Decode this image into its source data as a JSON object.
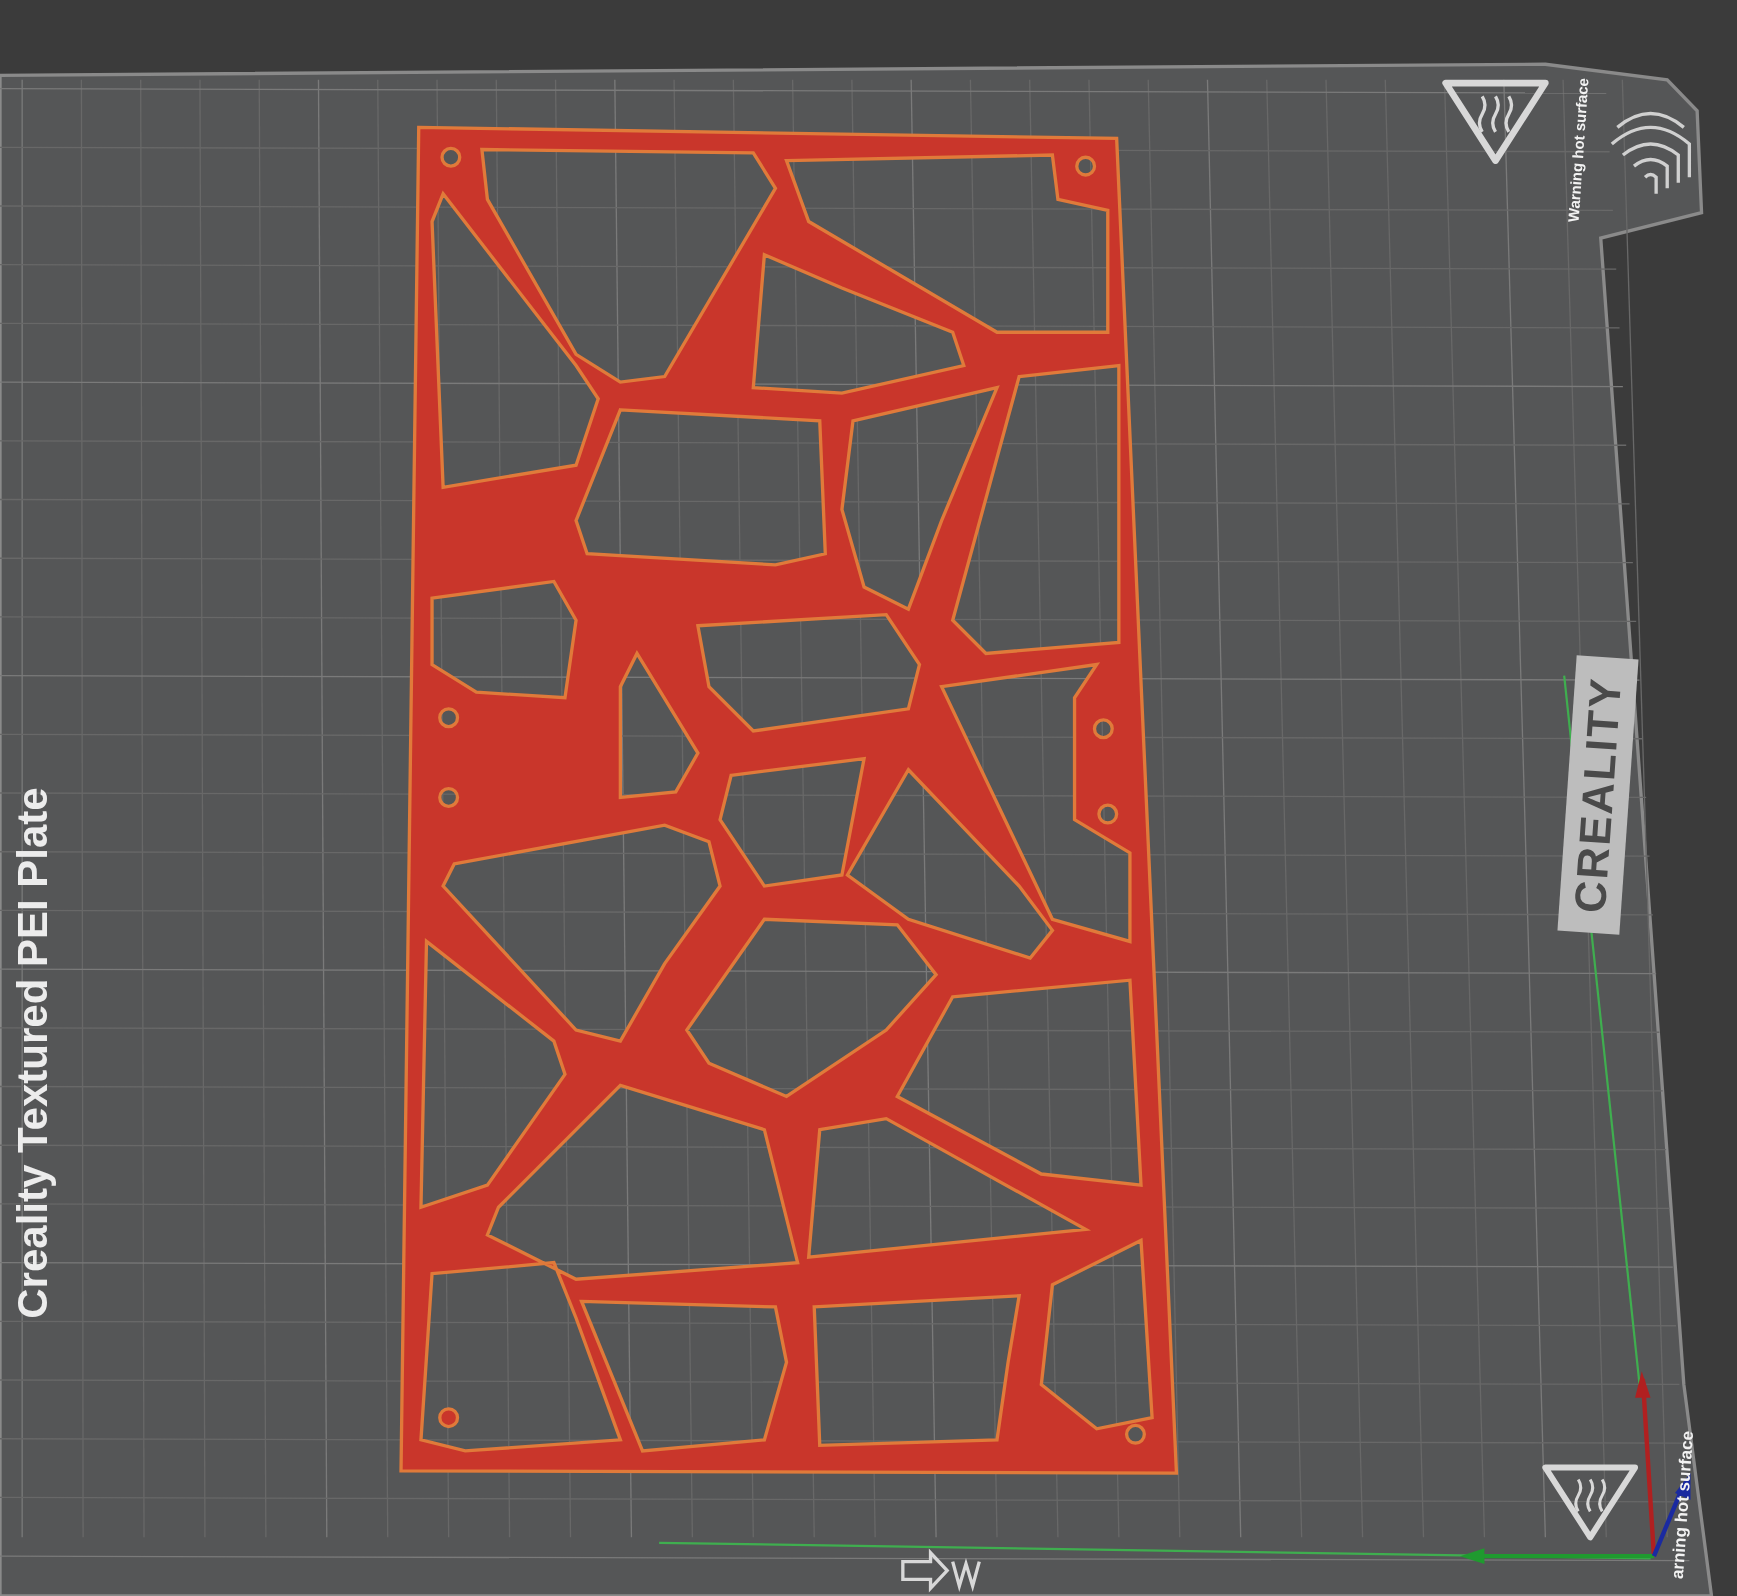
{
  "plate": {
    "name": "Creality Textured PEI Plate",
    "brand": "CREALITY",
    "warnings": [
      "Warning hot surface",
      "arning hot surface"
    ]
  }
}
